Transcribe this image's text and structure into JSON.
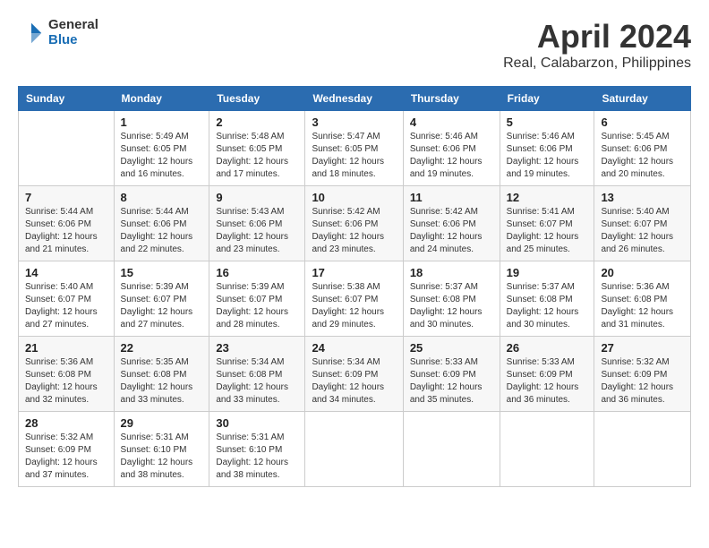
{
  "header": {
    "logo_general": "General",
    "logo_blue": "Blue",
    "month_year": "April 2024",
    "location": "Real, Calabarzon, Philippines"
  },
  "days_of_week": [
    "Sunday",
    "Monday",
    "Tuesday",
    "Wednesday",
    "Thursday",
    "Friday",
    "Saturday"
  ],
  "weeks": [
    [
      {
        "day": "",
        "sunrise": "",
        "sunset": "",
        "daylight": ""
      },
      {
        "day": "1",
        "sunrise": "Sunrise: 5:49 AM",
        "sunset": "Sunset: 6:05 PM",
        "daylight": "Daylight: 12 hours and 16 minutes."
      },
      {
        "day": "2",
        "sunrise": "Sunrise: 5:48 AM",
        "sunset": "Sunset: 6:05 PM",
        "daylight": "Daylight: 12 hours and 17 minutes."
      },
      {
        "day": "3",
        "sunrise": "Sunrise: 5:47 AM",
        "sunset": "Sunset: 6:05 PM",
        "daylight": "Daylight: 12 hours and 18 minutes."
      },
      {
        "day": "4",
        "sunrise": "Sunrise: 5:46 AM",
        "sunset": "Sunset: 6:06 PM",
        "daylight": "Daylight: 12 hours and 19 minutes."
      },
      {
        "day": "5",
        "sunrise": "Sunrise: 5:46 AM",
        "sunset": "Sunset: 6:06 PM",
        "daylight": "Daylight: 12 hours and 19 minutes."
      },
      {
        "day": "6",
        "sunrise": "Sunrise: 5:45 AM",
        "sunset": "Sunset: 6:06 PM",
        "daylight": "Daylight: 12 hours and 20 minutes."
      }
    ],
    [
      {
        "day": "7",
        "sunrise": "Sunrise: 5:44 AM",
        "sunset": "Sunset: 6:06 PM",
        "daylight": "Daylight: 12 hours and 21 minutes."
      },
      {
        "day": "8",
        "sunrise": "Sunrise: 5:44 AM",
        "sunset": "Sunset: 6:06 PM",
        "daylight": "Daylight: 12 hours and 22 minutes."
      },
      {
        "day": "9",
        "sunrise": "Sunrise: 5:43 AM",
        "sunset": "Sunset: 6:06 PM",
        "daylight": "Daylight: 12 hours and 23 minutes."
      },
      {
        "day": "10",
        "sunrise": "Sunrise: 5:42 AM",
        "sunset": "Sunset: 6:06 PM",
        "daylight": "Daylight: 12 hours and 23 minutes."
      },
      {
        "day": "11",
        "sunrise": "Sunrise: 5:42 AM",
        "sunset": "Sunset: 6:06 PM",
        "daylight": "Daylight: 12 hours and 24 minutes."
      },
      {
        "day": "12",
        "sunrise": "Sunrise: 5:41 AM",
        "sunset": "Sunset: 6:07 PM",
        "daylight": "Daylight: 12 hours and 25 minutes."
      },
      {
        "day": "13",
        "sunrise": "Sunrise: 5:40 AM",
        "sunset": "Sunset: 6:07 PM",
        "daylight": "Daylight: 12 hours and 26 minutes."
      }
    ],
    [
      {
        "day": "14",
        "sunrise": "Sunrise: 5:40 AM",
        "sunset": "Sunset: 6:07 PM",
        "daylight": "Daylight: 12 hours and 27 minutes."
      },
      {
        "day": "15",
        "sunrise": "Sunrise: 5:39 AM",
        "sunset": "Sunset: 6:07 PM",
        "daylight": "Daylight: 12 hours and 27 minutes."
      },
      {
        "day": "16",
        "sunrise": "Sunrise: 5:39 AM",
        "sunset": "Sunset: 6:07 PM",
        "daylight": "Daylight: 12 hours and 28 minutes."
      },
      {
        "day": "17",
        "sunrise": "Sunrise: 5:38 AM",
        "sunset": "Sunset: 6:07 PM",
        "daylight": "Daylight: 12 hours and 29 minutes."
      },
      {
        "day": "18",
        "sunrise": "Sunrise: 5:37 AM",
        "sunset": "Sunset: 6:08 PM",
        "daylight": "Daylight: 12 hours and 30 minutes."
      },
      {
        "day": "19",
        "sunrise": "Sunrise: 5:37 AM",
        "sunset": "Sunset: 6:08 PM",
        "daylight": "Daylight: 12 hours and 30 minutes."
      },
      {
        "day": "20",
        "sunrise": "Sunrise: 5:36 AM",
        "sunset": "Sunset: 6:08 PM",
        "daylight": "Daylight: 12 hours and 31 minutes."
      }
    ],
    [
      {
        "day": "21",
        "sunrise": "Sunrise: 5:36 AM",
        "sunset": "Sunset: 6:08 PM",
        "daylight": "Daylight: 12 hours and 32 minutes."
      },
      {
        "day": "22",
        "sunrise": "Sunrise: 5:35 AM",
        "sunset": "Sunset: 6:08 PM",
        "daylight": "Daylight: 12 hours and 33 minutes."
      },
      {
        "day": "23",
        "sunrise": "Sunrise: 5:34 AM",
        "sunset": "Sunset: 6:08 PM",
        "daylight": "Daylight: 12 hours and 33 minutes."
      },
      {
        "day": "24",
        "sunrise": "Sunrise: 5:34 AM",
        "sunset": "Sunset: 6:09 PM",
        "daylight": "Daylight: 12 hours and 34 minutes."
      },
      {
        "day": "25",
        "sunrise": "Sunrise: 5:33 AM",
        "sunset": "Sunset: 6:09 PM",
        "daylight": "Daylight: 12 hours and 35 minutes."
      },
      {
        "day": "26",
        "sunrise": "Sunrise: 5:33 AM",
        "sunset": "Sunset: 6:09 PM",
        "daylight": "Daylight: 12 hours and 36 minutes."
      },
      {
        "day": "27",
        "sunrise": "Sunrise: 5:32 AM",
        "sunset": "Sunset: 6:09 PM",
        "daylight": "Daylight: 12 hours and 36 minutes."
      }
    ],
    [
      {
        "day": "28",
        "sunrise": "Sunrise: 5:32 AM",
        "sunset": "Sunset: 6:09 PM",
        "daylight": "Daylight: 12 hours and 37 minutes."
      },
      {
        "day": "29",
        "sunrise": "Sunrise: 5:31 AM",
        "sunset": "Sunset: 6:10 PM",
        "daylight": "Daylight: 12 hours and 38 minutes."
      },
      {
        "day": "30",
        "sunrise": "Sunrise: 5:31 AM",
        "sunset": "Sunset: 6:10 PM",
        "daylight": "Daylight: 12 hours and 38 minutes."
      },
      {
        "day": "",
        "sunrise": "",
        "sunset": "",
        "daylight": ""
      },
      {
        "day": "",
        "sunrise": "",
        "sunset": "",
        "daylight": ""
      },
      {
        "day": "",
        "sunrise": "",
        "sunset": "",
        "daylight": ""
      },
      {
        "day": "",
        "sunrise": "",
        "sunset": "",
        "daylight": ""
      }
    ]
  ]
}
